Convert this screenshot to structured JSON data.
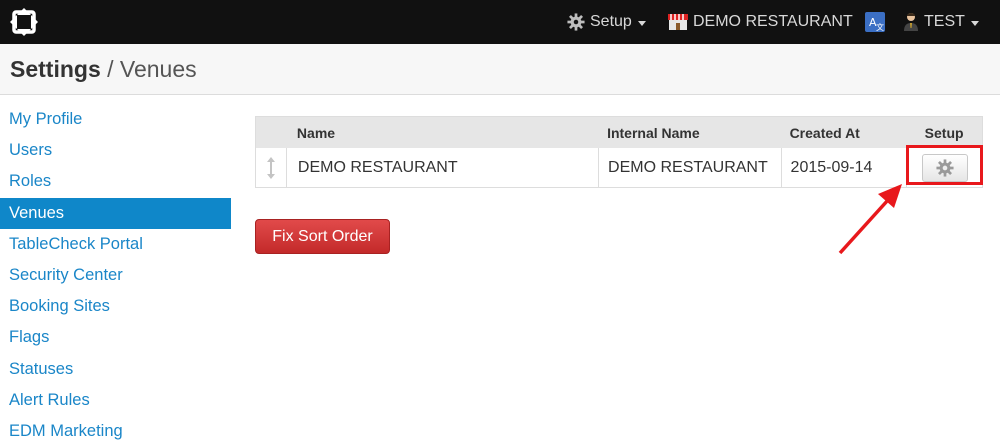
{
  "topnav": {
    "logo_icon": "tablecheck-logo-icon",
    "setup_label": "Setup",
    "venue_label": "DEMO RESTAURANT",
    "language_icon": "translate-icon",
    "user_label": "TEST"
  },
  "header": {
    "section": "Settings",
    "separator": " / ",
    "page": "Venues"
  },
  "sidebar": {
    "items": [
      {
        "label": "My Profile"
      },
      {
        "label": "Users"
      },
      {
        "label": "Roles"
      },
      {
        "label": "Venues"
      },
      {
        "label": "TableCheck Portal"
      },
      {
        "label": "Security Center"
      },
      {
        "label": "Booking Sites"
      },
      {
        "label": "Flags"
      },
      {
        "label": "Statuses"
      },
      {
        "label": "Alert Rules"
      },
      {
        "label": "EDM Marketing"
      }
    ],
    "active": "Venues"
  },
  "table": {
    "columns": [
      "Name",
      "Internal Name",
      "Created At",
      "Setup"
    ],
    "rows": [
      {
        "name": "DEMO RESTAURANT",
        "internal_name": "DEMO RESTAURANT",
        "created_at": "2015-09-14",
        "setup_icon": "gear-icon",
        "drag_icon": "sort-handle-icon"
      }
    ]
  },
  "fix_sort_order_label": "Fix Sort Order",
  "colors": {
    "nav_bg": "#111111",
    "link": "#1a86c8",
    "active_bg": "#0f87c9",
    "danger": "#d13b3b",
    "highlight": "#e8181c"
  }
}
